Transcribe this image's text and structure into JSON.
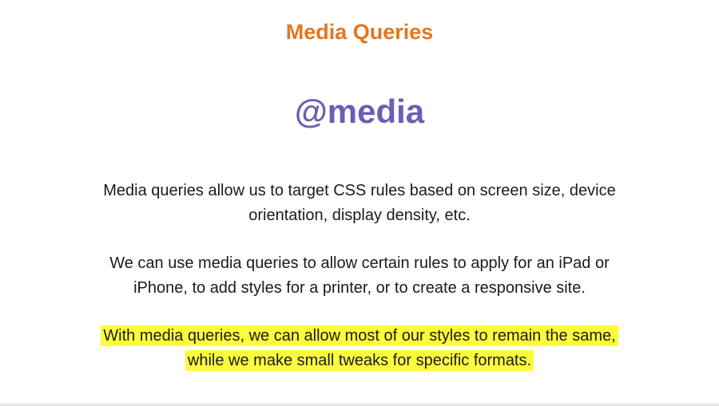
{
  "colors": {
    "title": "#e4761f",
    "subtitle": "#6a5fb4",
    "highlight": "#fcfc3c"
  },
  "slide": {
    "title": "Media Queries",
    "subtitle": "@media",
    "paragraphs": {
      "first_line1": "Media queries allow us to target CSS rules based on screen size, device",
      "first_line2": "orientation, display density, etc.",
      "second_line1": "We can use media queries to allow certain rules to apply for an iPad or",
      "second_line2": "iPhone, to add styles for a printer, or to create a responsive site.",
      "third_line1": "With media queries, we can allow most of our styles to remain the same,",
      "third_line2": "while we make small tweaks for specific formats."
    }
  }
}
